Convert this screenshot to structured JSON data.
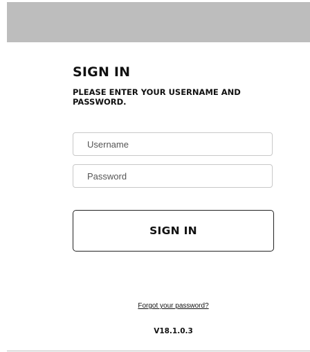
{
  "header": {
    "band_color": "#bdbdbd"
  },
  "login": {
    "title": "SIGN IN",
    "subtitle": "PLEASE ENTER YOUR USERNAME AND PASSWORD.",
    "username": {
      "placeholder": "Username",
      "value": ""
    },
    "password": {
      "placeholder": "Password",
      "value": ""
    },
    "submit_label": "SIGN IN",
    "forgot_link": "Forgot your password?",
    "version": "V18.1.0.3"
  }
}
